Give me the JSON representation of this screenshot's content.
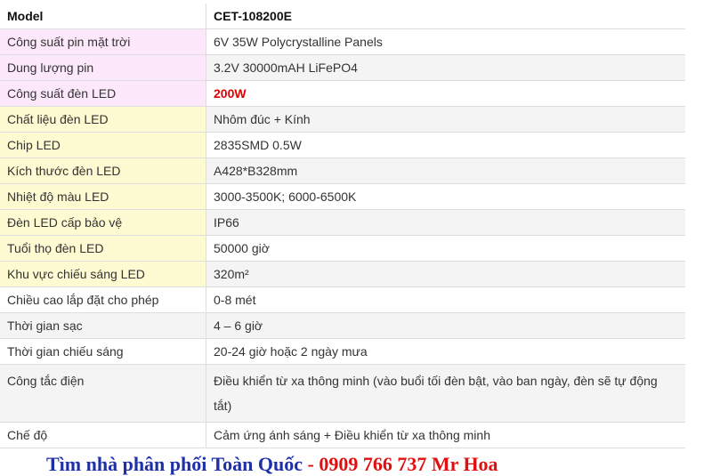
{
  "header": {
    "label": "Model",
    "value": "CET-108200E"
  },
  "rows": [
    {
      "label": "Công suất pin mặt trời",
      "value": "6V 35W Polycrystalline Panels",
      "label_bg": "#fde8fb"
    },
    {
      "label": "Dung lượng pin",
      "value": "3.2V 30000mAH LiFePO4",
      "label_bg": "#fde8fb"
    },
    {
      "label": "Công suất đèn LED",
      "value": "200W",
      "label_bg": "#fde8fb",
      "value_color": "#e00000"
    },
    {
      "label": "Chất liệu đèn LED",
      "value": "Nhôm đúc + Kính",
      "label_bg": "#fefad1"
    },
    {
      "label": "Chip LED",
      "value": "2835SMD 0.5W",
      "label_bg": "#fefad1"
    },
    {
      "label": "Kích thước đèn LED",
      "value": "A428*B328mm",
      "label_bg": "#fefad1"
    },
    {
      "label": "Nhiệt độ màu LED",
      "value": "3000-3500K; 6000-6500K",
      "label_bg": "#fefad1"
    },
    {
      "label": "Đèn LED cấp bảo vệ",
      "value": "IP66",
      "label_bg": "#fefad1"
    },
    {
      "label": "Tuổi thọ đèn LED",
      "value": "50000 giờ",
      "label_bg": "#fefad1"
    },
    {
      "label": "Khu vực chiếu sáng LED",
      "value": "320m²",
      "label_bg": "#fefad1"
    },
    {
      "label": "Chiều cao lắp đặt cho phép",
      "value": "0-8 mét",
      "label_bg": "#ffffff"
    },
    {
      "label": "Thời gian sạc",
      "value": "4 – 6 giờ",
      "label_bg": "#ffffff"
    },
    {
      "label": "Thời gian chiếu sáng",
      "value": "20-24 giờ hoặc 2 ngày mưa",
      "label_bg": "#ffffff"
    },
    {
      "label": "Công tắc điện",
      "value": "Điều khiển từ xa thông minh (vào buổi tối đèn bật, vào ban ngày, đèn sẽ tự động tắt)",
      "label_bg": "#ffffff"
    },
    {
      "label": "Chế độ",
      "value": "Cảm ứng ánh sáng + Điều khiển từ xa thông minh",
      "label_bg": "#ffffff"
    }
  ],
  "footer": {
    "text_blue": "Tìm nhà phân phối Toàn Quốc",
    "separator": " - ",
    "text_red": "0909 766 737 Mr Hoa"
  }
}
